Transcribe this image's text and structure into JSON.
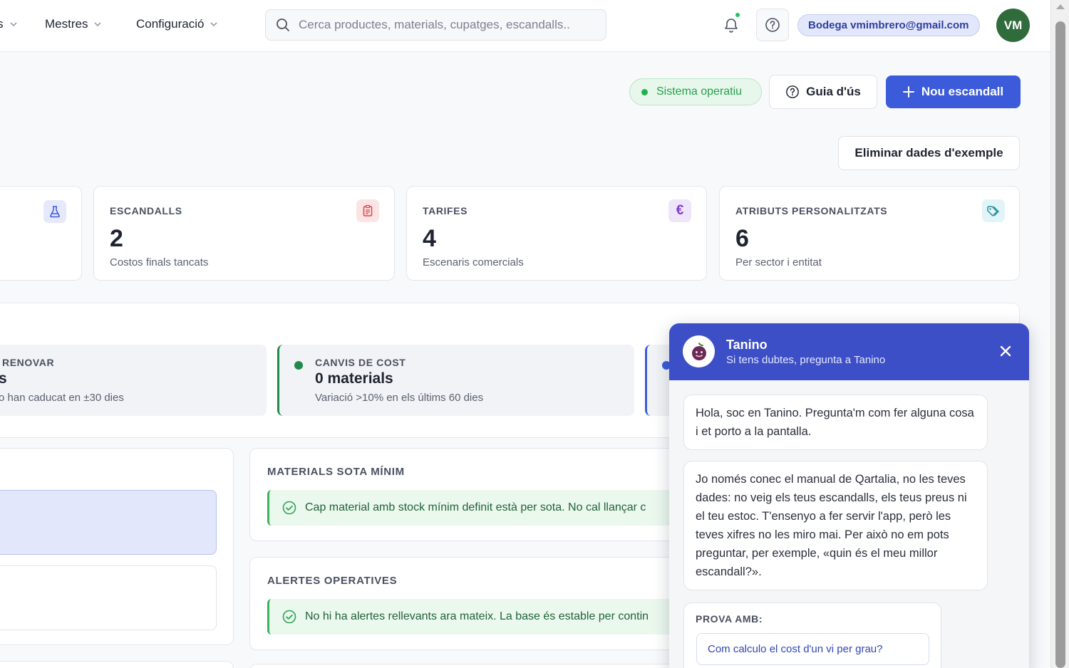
{
  "nav": {
    "partial_item": "s",
    "items": [
      "Mestres",
      "Configuració"
    ]
  },
  "search": {
    "placeholder": "Cerca productes, materials, cupatges, escandalls.."
  },
  "user": {
    "label": "Bodega vmimbrero@gmail.com",
    "initials": "VM"
  },
  "header_actions": {
    "status": "Sistema operatiu",
    "guide": "Guia d'ús",
    "new": "Nou escandall",
    "delete_sample": "Eliminar dades d'exemple"
  },
  "stats": [
    {
      "label": "ESCANDALLS",
      "value": "2",
      "sub": "Costos finals tancats",
      "icon": "clipboard-icon"
    },
    {
      "label": "TARIFES",
      "value": "4",
      "sub": "Escenaris comercials",
      "icon": "euro-icon"
    },
    {
      "label": "ATRIBUTS PERSONALITZATS",
      "value": "6",
      "sub": "Per sector i entitat",
      "icon": "tags-icon"
    }
  ],
  "partial_stat_icon": "flask-icon",
  "alerts": [
    {
      "title": "RENOVAR",
      "main": "s",
      "sub": "o han caducat en ±30 dies"
    },
    {
      "title": "CANVIS DE COST",
      "main": "0 materials",
      "sub": "Variació >10% en els últims 60 dies"
    }
  ],
  "sections": {
    "materials_min": {
      "title": "MATERIALS SOTA MÍNIM",
      "message": "Cap material amb stock mínim definit està per sota. No cal llançar c"
    },
    "op_alerts": {
      "title": "ALERTES OPERATIVES",
      "message": "No hi ha alertes rellevants ara mateix. La base és estable per contin"
    }
  },
  "chat": {
    "name": "Tanino",
    "subtitle": "Si tens dubtes, pregunta a Tanino",
    "messages": [
      "Hola, soc en Tanino. Pregunta'm com fer alguna cosa i et porto a la pantalla.",
      "Jo només conec el manual de Qartalia, no les teves dades: no veig els teus escandalls, els teus preus ni el teu estoc. T'ensenyo a fer servir l'app, però les teves xifres no les miro mai. Per això no em pots preguntar, per exemple, «quin és el meu millor escandall?»."
    ],
    "try_label": "PROVA AMB:",
    "suggestions": [
      "Com calculo el cost d'un vi per grau?"
    ]
  },
  "colors": {
    "primary": "#3b5bdb",
    "chat_header": "#3d4fc7",
    "success": "#22b04e",
    "avatar_bg": "#2f6b3b"
  }
}
